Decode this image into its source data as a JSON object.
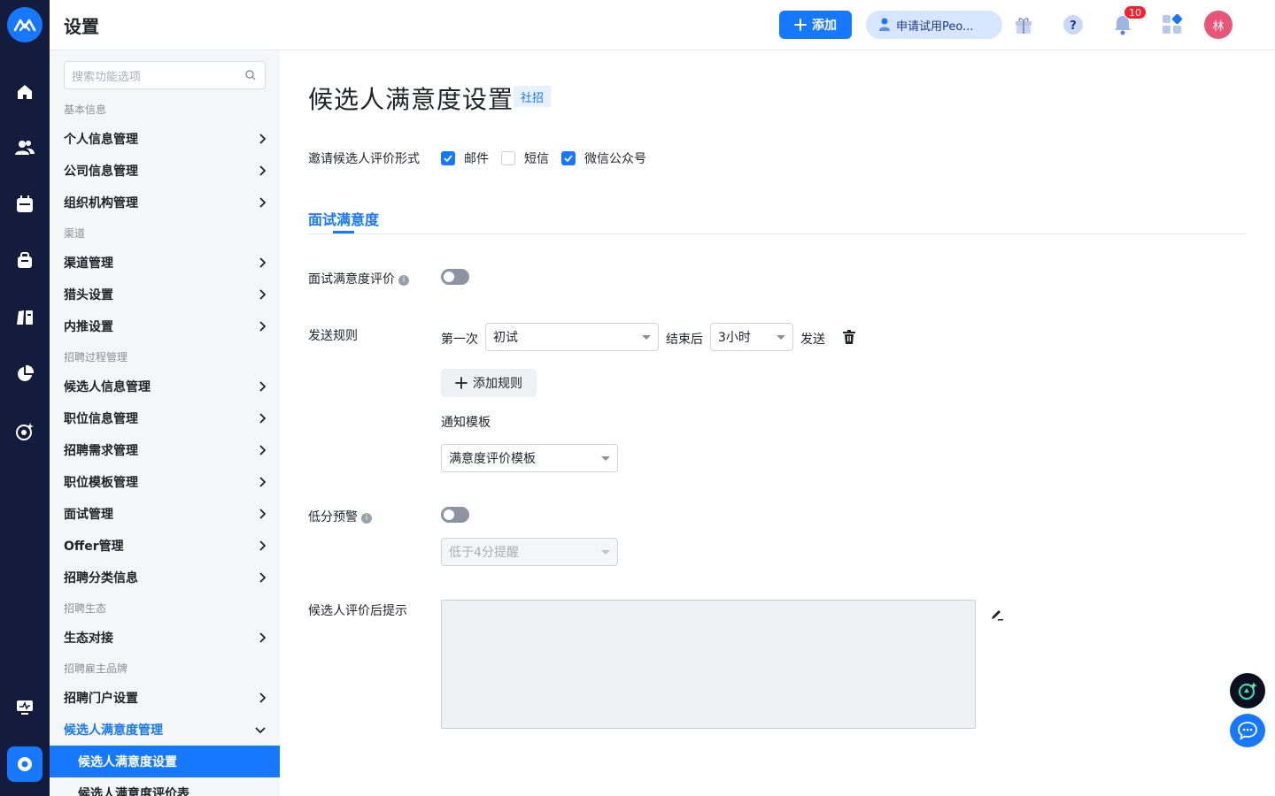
{
  "rail": {
    "icons": [
      "logo-icon",
      "home-icon",
      "people-icon",
      "calendar-icon",
      "briefcase-icon",
      "card-icon",
      "pie-chart-icon",
      "target-icon",
      "monitor-icon",
      "settings-icon"
    ]
  },
  "topbar": {
    "title": "设置",
    "add_label": "添加",
    "trial_label": "申请试用Peo...",
    "notification_count": "10",
    "avatar_text": "林"
  },
  "sidebar": {
    "search_placeholder": "搜索功能选项",
    "groups": [
      {
        "title": "基本信息",
        "items": [
          "个人信息管理",
          "公司信息管理",
          "组织机构管理"
        ]
      },
      {
        "title": "渠道",
        "items": [
          "渠道管理",
          "猎头设置",
          "内推设置"
        ]
      },
      {
        "title": "招聘过程管理",
        "items": [
          "候选人信息管理",
          "职位信息管理",
          "招聘需求管理",
          "职位模板管理",
          "面试管理",
          "Offer管理",
          "招聘分类信息"
        ]
      },
      {
        "title": "招聘生态",
        "items": [
          "生态对接"
        ]
      },
      {
        "title": "招聘雇主品牌",
        "items": [
          "招聘门户设置",
          "候选人满意度管理"
        ]
      }
    ],
    "sub_items": [
      "候选人满意度设置",
      "候选人满意度评价表"
    ]
  },
  "main": {
    "heading": "候选人满意度设置",
    "tag": "社招",
    "invite_label": "邀请候选人评价形式",
    "invite_options": [
      {
        "label": "邮件",
        "checked": true
      },
      {
        "label": "短信",
        "checked": false
      },
      {
        "label": "微信公众号",
        "checked": true
      }
    ],
    "tab": "面试满意度",
    "interview_eval_label": "面试满意度评价",
    "send_rule_label": "发送规则",
    "rule_prefix": "第一次",
    "rule_stage": "初试",
    "rule_after": "结束后",
    "rule_delay": "3小时",
    "rule_send": "发送",
    "add_rule_label": "添加规则",
    "notify_template_label": "通知模板",
    "notify_template_value": "满意度评价模板",
    "low_score_label": "低分预警",
    "low_score_placeholder": "低于4分提醒",
    "after_eval_label": "候选人评价后提示"
  },
  "colors": {
    "accent": "#1677ff",
    "rail": "#141c3d",
    "sidebar": "#f5f6f7"
  }
}
